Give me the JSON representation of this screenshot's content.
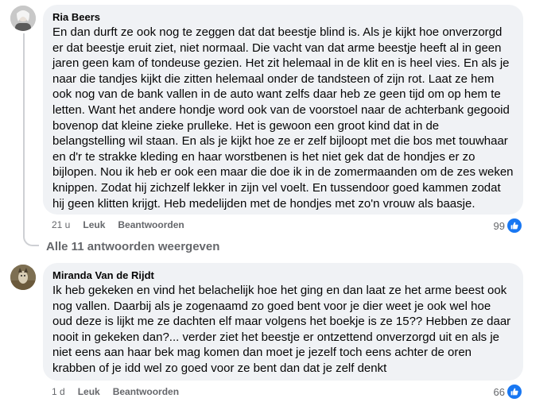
{
  "comments": [
    {
      "author": "Ria Beers",
      "text": "En dan durft ze ook nog te zeggen dat dat beestje blind is. Als je kijkt hoe onverzorgd er dat beestje eruit ziet, niet normaal. Die vacht van dat arme beestje heeft al in geen jaren geen kam of tondeuse gezien. Het zit helemaal in de klit en is heel vies. En als je naar die tandjes kijkt die zitten helemaal onder de tandsteen of zijn rot. Laat ze hem ook nog van de bank vallen in de auto want zelfs daar heb ze geen tijd om op hem te letten. Want het andere hondje word ook van de voorstoel naar de achterbank gegooid bovenop dat kleine zieke prulleke. Het is gewoon een groot kind dat in de belangstelling wil staan. En als je kijkt hoe ze er zelf bijloopt met die bos met touwhaar en d'r te strakke kleding en haar worstbenen is het niet gek dat de hondjes er zo bijlopen. Nou ik heb er ook een maar die doe ik in de zomermaanden om de zes weken knippen. Zodat hij zichzelf lekker in zijn vel voelt. En tussendoor goed kammen zodat hij geen klitten krijgt. Heb medelijden met de hondjes met zo'n vrouw als baasje.",
      "time": "21 u",
      "like_label": "Leuk",
      "reply_label": "Beantwoorden",
      "reaction_count": "99"
    },
    {
      "author": "Miranda Van de Rijdt",
      "text": "Ik heb gekeken en vind het belachelijk hoe het ging en dan laat ze het arme beest ook nog vallen. Daarbij als je zogenaamd zo goed bent voor je dier weet je ook wel hoe oud deze is lijkt me ze dachten elf maar volgens het boekje is ze 15?? Hebben ze daar nooit in gekeken dan?... verder ziet het beestje er ontzettend onverzorgd uit en als je niet eens aan haar bek mag komen dan moet je jezelf toch eens achter de oren krabben of je idd wel zo goed voor ze bent dan dat je zelf denkt",
      "time": "1 d",
      "like_label": "Leuk",
      "reply_label": "Beantwoorden",
      "reaction_count": "66"
    }
  ],
  "replies_link": "Alle 11 antwoorden weergeven",
  "icons": {
    "reaction": "like-thumb-icon"
  },
  "colors": {
    "bubble": "#f0f2f5",
    "meta": "#65676b",
    "like": "#1877f2"
  }
}
